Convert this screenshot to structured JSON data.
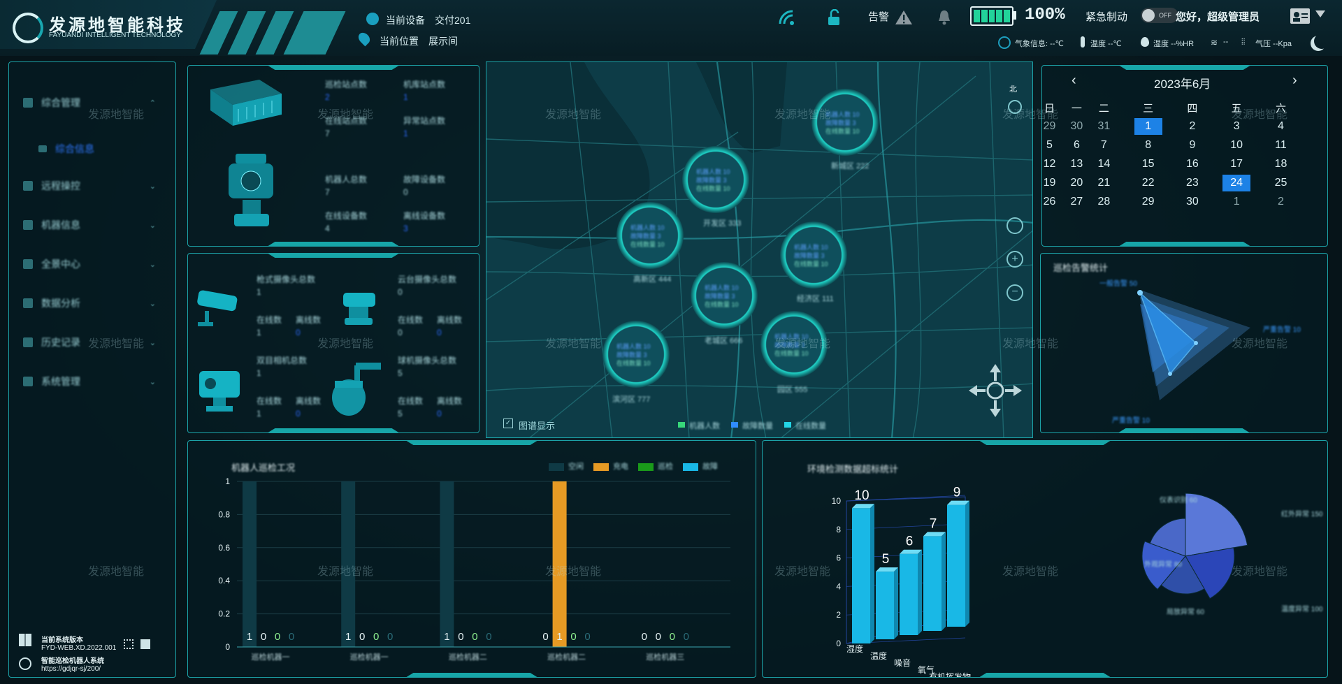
{
  "header": {
    "company_name": "发源地智能科技",
    "company_en": "FAYUANDI INTELLIGENT TECHNOLOGY",
    "device_label": "当前设备",
    "device_value": "交付201",
    "location_label": "当前位置",
    "location_value": "展示间",
    "alarm_label": "告警",
    "battery_percent": "100%",
    "emergency_stop_label": "紧急制动",
    "toggle_state": "OFF",
    "greeting": "您好，超级管理员",
    "weather": {
      "weather_label": "气象信息: --℃",
      "temp_label": "温度 --℃",
      "humidity_label": "湿度 --%HR",
      "wind_label": "--",
      "pressure_label": "气压 --Kpa"
    }
  },
  "sidebar": {
    "items": [
      {
        "label": "综合管理",
        "icon": "home-icon"
      },
      {
        "label": "综合信息",
        "icon": "info-icon",
        "sub": true
      },
      {
        "label": "远程操控",
        "icon": "monitor-icon"
      },
      {
        "label": "机器信息",
        "icon": "robot-icon"
      },
      {
        "label": "全景中心",
        "icon": "panorama-icon"
      },
      {
        "label": "数据分析",
        "icon": "chart-icon"
      },
      {
        "label": "历史记录",
        "icon": "history-icon"
      },
      {
        "label": "系统管理",
        "icon": "settings-icon"
      }
    ],
    "footer": {
      "version_title": "当前系统版本",
      "version": "FYD-WEB.XD.2022.001",
      "system_name": "智能巡检机器人系统",
      "url": "https://gdjqr-sj/200/"
    }
  },
  "stats_panel_1": {
    "top": [
      {
        "label": "巡检站点数",
        "value": "2"
      },
      {
        "label": "机库站点数",
        "value": "1"
      },
      {
        "label": "在线站点数",
        "value": "7"
      },
      {
        "label": "异常站点数",
        "value": "1"
      }
    ],
    "bottom": [
      {
        "label": "机器人总数",
        "value": "7"
      },
      {
        "label": "故障设备数",
        "value": "0"
      },
      {
        "label": "在线设备数",
        "value": "4"
      },
      {
        "label": "离线设备数",
        "value": "3"
      }
    ]
  },
  "stats_panel_2": {
    "cameras": [
      {
        "title": "枪式摄像头总数",
        "total": "1",
        "online_label": "在线数",
        "online": "1",
        "offline_label": "离线数",
        "offline": "0"
      },
      {
        "title": "云台摄像头总数",
        "total": "0",
        "online_label": "在线数",
        "online": "0",
        "offline_label": "离线数",
        "offline": "0"
      },
      {
        "title": "双目相机总数",
        "total": "1",
        "online_label": "在线数",
        "online": "1",
        "offline_label": "离线数",
        "offline": "0"
      },
      {
        "title": "球机摄像头总数",
        "total": "5",
        "online_label": "在线数",
        "online": "5",
        "offline_label": "离线数",
        "offline": "0"
      }
    ]
  },
  "map": {
    "north_label": "北",
    "legend_toggle": "图谱显示",
    "legend": [
      "机器人数",
      "故障数量",
      "在线数量"
    ],
    "legend_colors": [
      "#37d67a",
      "#2f8cff",
      "#23d5e6"
    ],
    "clusters": [
      {
        "name": "新城区 222",
        "l1": "机器人数 10",
        "l2": "故障数量 3",
        "l3": "在线数量 10"
      },
      {
        "name": "开发区 333",
        "l1": "机器人数 10",
        "l2": "故障数量 3",
        "l3": "在线数量 10"
      },
      {
        "name": "高新区 444",
        "l1": "机器人数 10",
        "l2": "故障数量 3",
        "l3": "在线数量 10"
      },
      {
        "name": "经济区 111",
        "l1": "机器人数 10",
        "l2": "故障数量 3",
        "l3": "在线数量 10"
      },
      {
        "name": "老城区 666",
        "l1": "机器人数 10",
        "l2": "故障数量 3",
        "l3": "在线数量 10"
      },
      {
        "name": "园区 555",
        "l1": "机器人数 10",
        "l2": "故障数量 3",
        "l3": "在线数量 10"
      },
      {
        "name": "滨河区 777",
        "l1": "机器人数 10",
        "l2": "故障数量 3",
        "l3": "在线数量 10"
      }
    ]
  },
  "calendar": {
    "title": "2023年6月",
    "weekdays": [
      "日",
      "一",
      "二",
      "三",
      "四",
      "五",
      "六"
    ],
    "weeks": [
      [
        "29",
        "30",
        "31",
        "1",
        "2",
        "3",
        "4"
      ],
      [
        "5",
        "6",
        "7",
        "8",
        "9",
        "10",
        "11"
      ],
      [
        "12",
        "13",
        "14",
        "15",
        "16",
        "17",
        "18"
      ],
      [
        "19",
        "20",
        "21",
        "22",
        "23",
        "24",
        "25"
      ],
      [
        "26",
        "27",
        "28",
        "29",
        "30",
        "1",
        "2"
      ]
    ]
  },
  "radar": {
    "title": "巡检告警统计",
    "labels": [
      "一般告警 50",
      "严重告警 10",
      "严重告警 10"
    ]
  },
  "bar_panel": {
    "title": "机器人巡检工况",
    "legend": [
      "空闲",
      "充电",
      "巡检",
      "故障"
    ],
    "legend_colors": [
      "#0f3a45",
      "#e69a24",
      "#1a9a1a",
      "#19b8e6"
    ]
  },
  "bar3d_panel": {
    "title": "环境检测数据超标统计"
  },
  "pie_panel": {
    "labels": [
      "红外异常 150",
      "温度异常 100",
      "局放异常 60",
      "外观异常 80",
      "仪表识别 60"
    ]
  },
  "chart_data": [
    {
      "type": "bar",
      "title": "机器人巡检工况",
      "categories": [
        "巡检机器一",
        "巡检机器一",
        "巡检机器二",
        "巡检机器二",
        "巡检机器三"
      ],
      "series": [
        {
          "name": "空闲",
          "values": [
            1,
            1,
            1,
            0,
            0
          ]
        },
        {
          "name": "充电",
          "values": [
            0,
            0,
            0,
            1,
            0
          ]
        },
        {
          "name": "巡检",
          "values": [
            0,
            0,
            0,
            0,
            0
          ]
        },
        {
          "name": "故障",
          "values": [
            0,
            0,
            0,
            0,
            0
          ]
        }
      ],
      "data_labels": [
        [
          "1",
          "0",
          "0",
          "0"
        ],
        [
          "1",
          "0",
          "0",
          "0"
        ],
        [
          "1",
          "0",
          "0",
          "0"
        ],
        [
          "0",
          "1",
          "0",
          "0"
        ],
        [
          "0",
          "0",
          "0",
          "0"
        ]
      ],
      "ylim": [
        0,
        1
      ],
      "yticks": [
        "0",
        "0.2",
        "0.4",
        "0.6",
        "0.8",
        "1"
      ]
    },
    {
      "type": "bar",
      "title": "环境检测数据超标统计",
      "categories": [
        "湿度",
        "温度",
        "噪音",
        "氧气",
        "有机挥发物"
      ],
      "values": [
        10,
        5,
        6,
        7,
        9
      ],
      "ylim": [
        0,
        10
      ],
      "yticks": [
        "0",
        "2",
        "4",
        "6",
        "8",
        "10"
      ]
    },
    {
      "type": "pie",
      "labels": [
        "红外异常 150",
        "温度异常 100",
        "局放异常 60",
        "外观异常 80",
        "仪表识别 60"
      ],
      "values": [
        150,
        100,
        60,
        80,
        60
      ]
    },
    {
      "type": "radar",
      "title": "巡检告警统计",
      "labels": [
        "一般告警 50",
        "严重告警 10",
        "严重告警 10"
      ],
      "values": [
        50,
        10,
        10
      ]
    }
  ],
  "watermark_text": "发源地智能"
}
